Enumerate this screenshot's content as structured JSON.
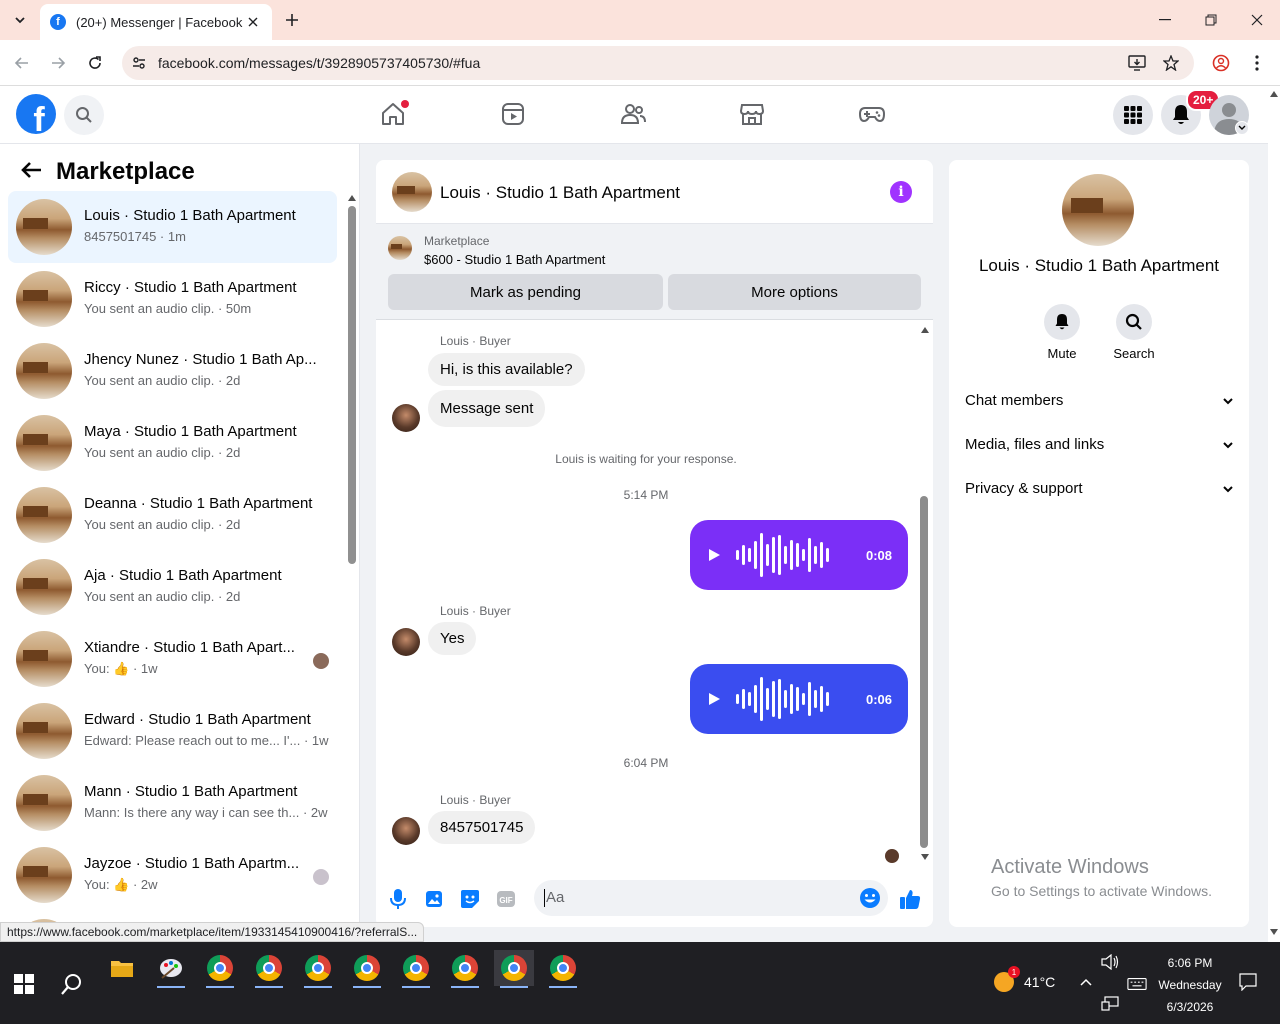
{
  "browser": {
    "tab_title": "(20+) Messenger | Facebook",
    "url": "facebook.com/messages/t/3928905737405730/#fua",
    "status_url": "https://www.facebook.com/marketplace/item/1933145410900416/?referralS..."
  },
  "fb_header": {
    "notif_badge": "20+"
  },
  "sidebar": {
    "title": "Marketplace",
    "conversations": [
      {
        "name": "Louis · Studio 1 Bath Apartment",
        "sub": "8457501745 · 1m"
      },
      {
        "name": "Riccy · Studio 1 Bath Apartment",
        "sub": "You sent an audio clip. · 50m"
      },
      {
        "name": "Jhency Nunez · Studio 1 Bath Ap...",
        "sub": "You sent an audio clip. · 2d"
      },
      {
        "name": "Maya · Studio 1 Bath Apartment",
        "sub": "You sent an audio clip. · 2d"
      },
      {
        "name": "Deanna · Studio 1 Bath Apartment",
        "sub": "You sent an audio clip. · 2d"
      },
      {
        "name": "Aja · Studio 1 Bath Apartment",
        "sub": "You sent an audio clip. · 2d"
      },
      {
        "name": "Xtiandre · Studio 1 Bath Apart...",
        "sub": "You: 👍 · 1w"
      },
      {
        "name": "Edward · Studio 1 Bath Apartment",
        "sub": "Edward: Please reach out to me... I'... · 1w"
      },
      {
        "name": "Mann · Studio 1 Bath Apartment",
        "sub": "Mann: Is there any way i can see th... · 2w"
      },
      {
        "name": "Jayzoe · Studio 1 Bath Apartm...",
        "sub": "You: 👍 · 2w"
      }
    ]
  },
  "chat": {
    "title": "Louis · Studio 1 Bath Apartment",
    "marketplace_label": "Marketplace",
    "listing": "$600 - Studio 1 Bath Apartment",
    "mark_pending": "Mark as pending",
    "more_options": "More options",
    "sender1": "Louis · Buyer",
    "msg1": "Hi, is this available?",
    "msg2": "Message sent",
    "waiting": "Louis is waiting for your response.",
    "time1": "5:14 PM",
    "audio1_duration": "0:08",
    "sender2": "Louis · Buyer",
    "msg3": "Yes",
    "audio2_duration": "0:06",
    "time2": "6:04 PM",
    "sender3": "Louis · Buyer",
    "msg4": "8457501745",
    "composer_placeholder": "Aa",
    "colors": {
      "audio1": "#7b2ff7",
      "audio2": "#3a4df0",
      "accent": "#0a7cff"
    }
  },
  "details": {
    "name": "Louis · Studio 1 Bath Apartment",
    "mute": "Mute",
    "search": "Search",
    "rows": [
      "Chat members",
      "Media, files and links",
      "Privacy & support"
    ]
  },
  "watermark": {
    "line1": "Activate Windows",
    "line2": "Go to Settings to activate Windows."
  },
  "taskbar": {
    "temperature": "41°C",
    "time": "6:06 PM",
    "day": "Wednesday",
    "date": "6/3/2026",
    "weather_badge": "1"
  }
}
